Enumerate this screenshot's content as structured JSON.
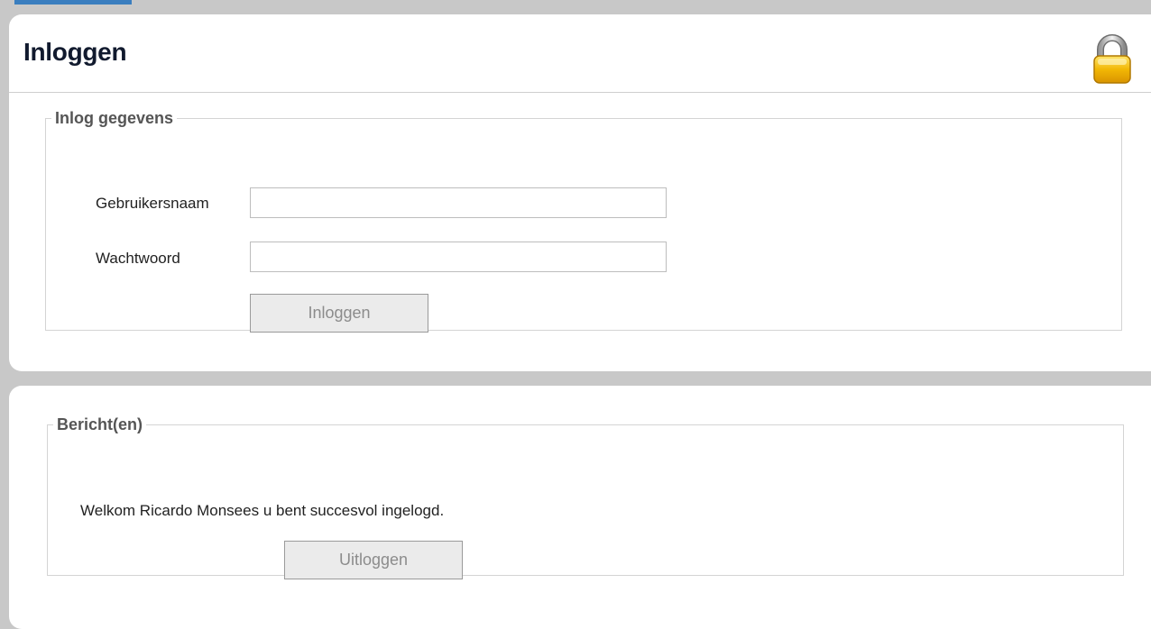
{
  "login_panel": {
    "title": "Inloggen",
    "lock_icon": "lock-icon",
    "fieldset_legend": "Inlog gegevens",
    "username_label": "Gebruikersnaam",
    "username_value": "",
    "password_label": "Wachtwoord",
    "password_value": "",
    "login_button": "Inloggen"
  },
  "message_panel": {
    "fieldset_legend": "Bericht(en)",
    "message": "Welkom Ricardo Monsees u bent succesvol ingelogd.",
    "logout_button": "Uitloggen"
  },
  "colors": {
    "background": "#c8c8c8",
    "panel": "#ffffff",
    "title": "#111a2e",
    "lock_body": "#f2b705",
    "accent_tab": "#3a7ebf"
  }
}
